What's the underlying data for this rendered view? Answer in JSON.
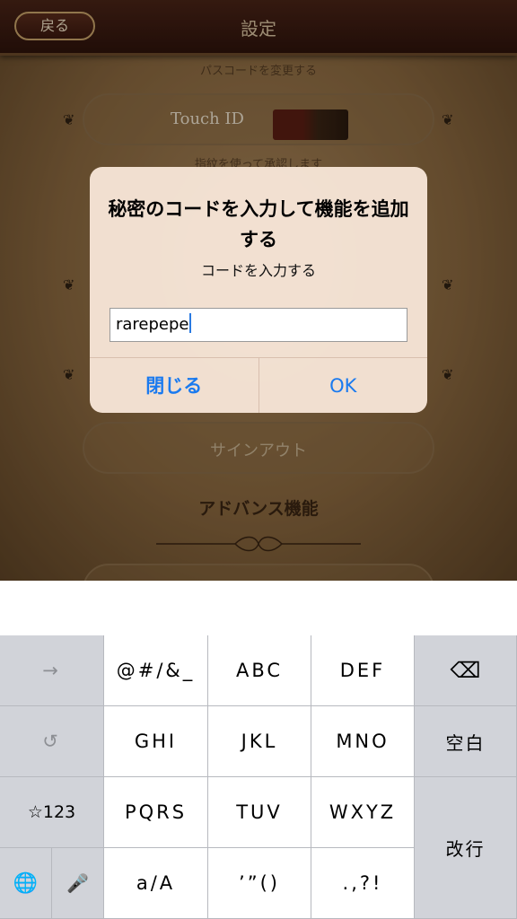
{
  "app": {
    "nav": {
      "back_label": "戻る",
      "title": "設定"
    },
    "caption_top": "パスコードを変更する",
    "touchid_label": "Touch ID",
    "touchid_caption": "指紋を使って承認します",
    "signout_label": "サインアウト",
    "section_title": "アドバンス機能"
  },
  "alert": {
    "title": "秘密のコードを入力して機能を追加する",
    "message": "コードを入力する",
    "input_value": "rarepepe",
    "cancel_label": "閉じる",
    "ok_label": "OK"
  },
  "keyboard": {
    "arrow": "→",
    "undo": "↺",
    "mode": "☆123",
    "globe": "🌐",
    "mic": "🎤",
    "k1": "@#/&_",
    "k2": "ABC",
    "k3": "DEF",
    "k4": "GHI",
    "k5": "JKL",
    "k6": "MNO",
    "k7": "PQRS",
    "k8": "TUV",
    "k9": "WXYZ",
    "k10": "a/A",
    "k11": "’”()",
    "k12": ".,?!",
    "delete": "⌫",
    "space": "空白",
    "return": "改行"
  },
  "colors": {
    "alert_button": "#1a7aef",
    "nav_bg": "#3a180e"
  }
}
